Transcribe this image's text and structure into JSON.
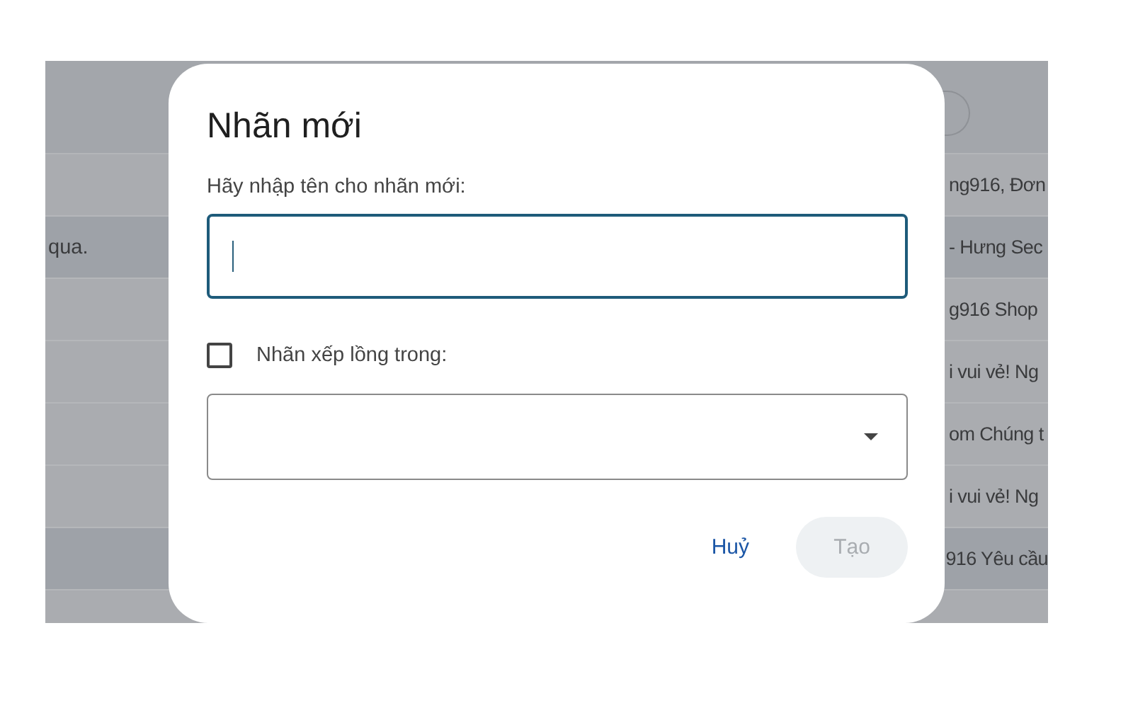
{
  "background_list": {
    "rows": [
      {
        "left_text": "",
        "right_text": "ng916, Đơn",
        "read": false
      },
      {
        "left_text": "qua.",
        "right_text": "- Hưng Sec",
        "read": true
      },
      {
        "left_text": "",
        "right_text": "g916 Shop",
        "read": false
      },
      {
        "left_text": "",
        "right_text": "i vui vẻ! Ng",
        "read": false
      },
      {
        "left_text": "",
        "right_text": "om Chúng t",
        "read": false
      },
      {
        "left_text": "",
        "right_text": "i vui vẻ! Ng",
        "read": false
      },
      {
        "left_text": "",
        "right_text": "916 Yêu cầu",
        "read": true
      }
    ]
  },
  "dialog": {
    "title": "Nhãn mới",
    "prompt": "Hãy nhập tên cho nhãn mới:",
    "name_field": {
      "focused": true
    },
    "nest_option": {
      "label": "Nhãn xếp lồng trong:",
      "checked": false
    },
    "parent_select": {
      "disabled": false
    },
    "buttons": [
      {
        "label": "Huỷ",
        "kind": "text",
        "disabled": false
      },
      {
        "label": "Tạo",
        "kind": "filled",
        "disabled": true
      }
    ]
  }
}
